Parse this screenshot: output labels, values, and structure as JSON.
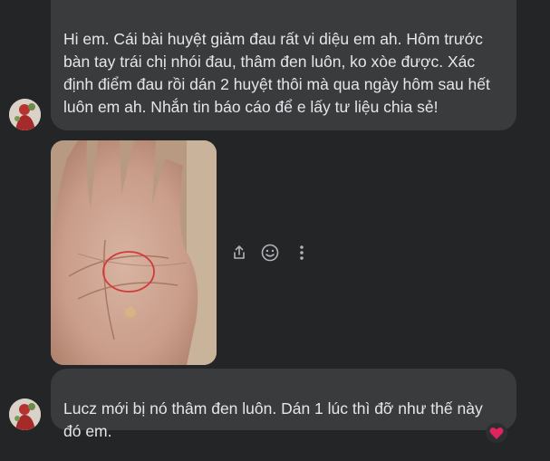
{
  "messages": [
    {
      "text": "Hi em. Cái bài huyệt giảm đau rất vi diệu em ah. Hôm trước bàn tay trái chị nhói đau, thâm đen luôn,  ko  xòe được. Xác định điểm đau rồi dán 2 huyệt thôi mà qua ngày hôm sau hết luôn em ah. Nhắn tin báo cáo để e lấy tư liệu chia sẻ!"
    },
    {
      "text": "Lucz mới bị nó thâm đen luôn. Dán 1 lúc thì đỡ như thế này đó em."
    }
  ],
  "photo": {
    "subject": "palm-photo",
    "annotation_color": "#d23a3a"
  },
  "actions": [
    "share-icon",
    "emoji-icon",
    "more-options-icon"
  ],
  "reaction": {
    "icon": "heart-icon",
    "color": "#e0245e"
  },
  "colors": {
    "background": "#242526",
    "bubble": "#3a3b3c",
    "text": "#e4e6eb",
    "icon": "#b0b3b8"
  }
}
